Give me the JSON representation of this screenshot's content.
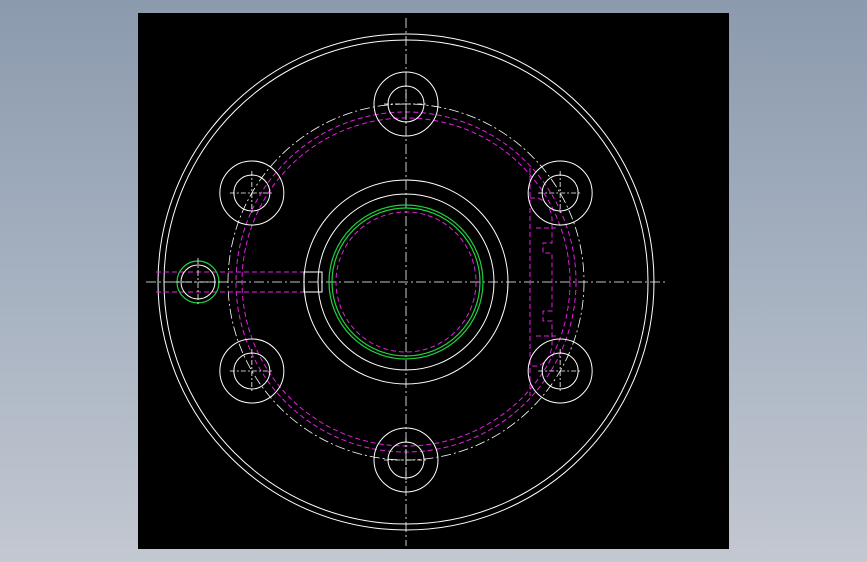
{
  "drawing": {
    "background_color": "#000000",
    "line_colors": {
      "outline": "#ffffff",
      "hidden": "#e020e0",
      "thread": "#20d040",
      "centerline": "#ffffff"
    },
    "bolt_hole_count": 6
  }
}
